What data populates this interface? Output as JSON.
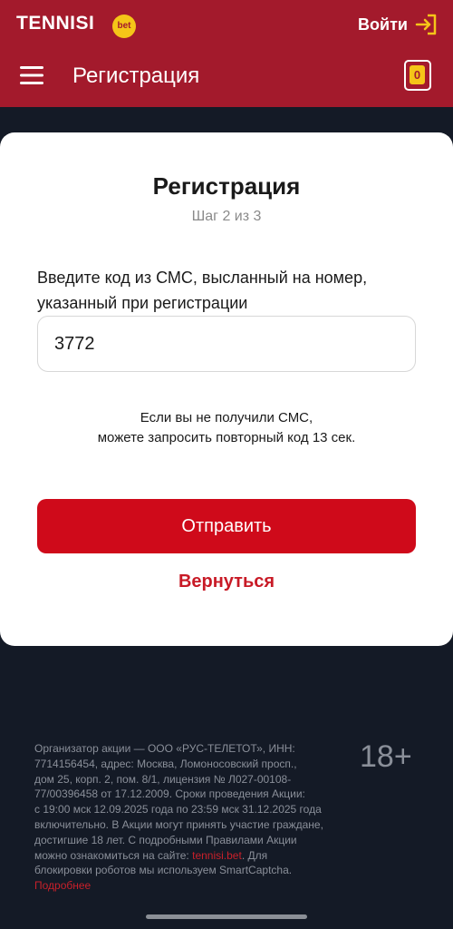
{
  "header": {
    "brand_name": "TENNISI",
    "brand_badge": "bet",
    "login_label": "Войти",
    "page_title": "Регистрация",
    "coupon_count": "0",
    "colors": {
      "header_bg": "#a31a2c",
      "accent_yellow": "#f5c518"
    }
  },
  "card": {
    "title": "Регистрация",
    "step": "Шаг 2 из 3",
    "code_label_line1": "Введите код из СМС, высланный на номер,",
    "code_label_line2": "указанный при регистрации",
    "code_value": "3772",
    "resend_line1": "Если вы не получили СМС,",
    "resend_line2": "можете запросить повторный код 13 сек.",
    "submit_label": "Отправить",
    "back_label": "Вернуться",
    "colors": {
      "primary_button": "#cf0a1a",
      "link_red": "#c81a26"
    }
  },
  "footer": {
    "lines": [
      "Организатор акции — ООО «РУС-ТЕЛЕТОТ», ИНН:",
      "7714156454, адрес: Москва, Ломоносовский просп.,",
      "дом 25, корп. 2, пом. 8/1, лицензия № Л027-00108-",
      "77/00396458 от 17.12.2009. Сроки проведения Акции:",
      "с 19:00 мск 12.09.2025 года по 23:59 мск 31.12.2025 года",
      "включительно. В Акции могут принять участие граждане,",
      "достигшие 18 лет. С подробными Правилами Акции"
    ],
    "line8_prefix": "можно ознакомиться на сайте: ",
    "site_link": "tennisi.bet",
    "line8_suffix": ". Для",
    "line9": "блокировки роботов мы используем SmartCaptcha.",
    "more_link": "Подробнее",
    "age_badge": "18+"
  },
  "icons": [
    "menu-icon",
    "login-arrow-icon",
    "coupon-icon"
  ]
}
